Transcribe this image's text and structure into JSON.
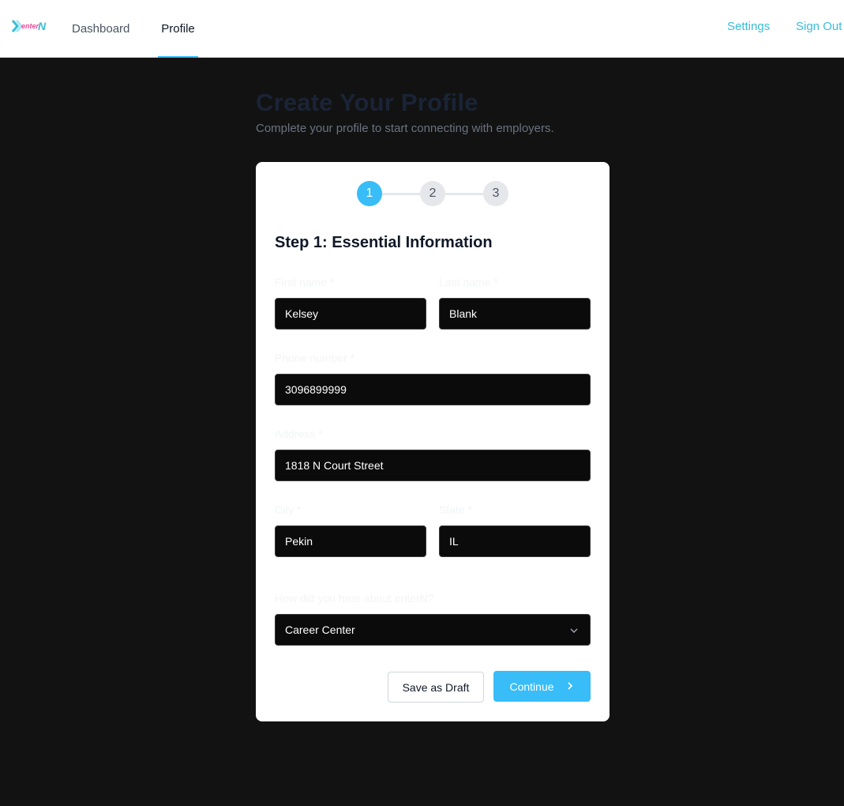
{
  "nav": {
    "logo_text": "enterN",
    "links": [
      {
        "label": "Dashboard"
      },
      {
        "label": "Profile"
      }
    ],
    "settings_label": "Settings",
    "signout_label": "Sign Out",
    "active_color": "#38bdf8"
  },
  "page": {
    "title": "Create Your Profile",
    "subtitle": "Complete your profile to start connecting with employers."
  },
  "stepper": {
    "steps": [
      "1",
      "2",
      "3"
    ],
    "active_step": 1
  },
  "form": {
    "heading": "Step 1: Essential Information",
    "first_name": {
      "label": "First name *",
      "value": "Kelsey"
    },
    "last_name": {
      "label": "Last name *",
      "value": "Blank"
    },
    "phone": {
      "label": "Phone number *",
      "value": "3096899999"
    },
    "address": {
      "label": "Address *",
      "value": "1818 N Court Street"
    },
    "city": {
      "label": "City *",
      "value": "Pekin"
    },
    "state": {
      "label": "State *",
      "value": "IL"
    },
    "referral": {
      "label": "How did you hear about enterN?",
      "value": "Career Center"
    }
  },
  "actions": {
    "draft_label": "Save as Draft",
    "continue_label": "Continue"
  },
  "icons": {
    "logo": "entern-logo-icon",
    "chevron": "chevron-down-icon",
    "continue": "chevron-right-icon"
  }
}
